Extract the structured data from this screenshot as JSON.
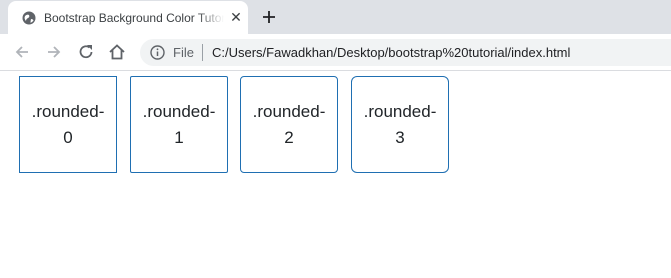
{
  "browser": {
    "tab": {
      "title": "Bootstrap Background Color Tutorial",
      "close_label": "✕"
    },
    "address": {
      "scheme_label": "File",
      "url": "C:/Users/Fawadkhan/Desktop/bootstrap%20tutorial/index.html"
    }
  },
  "page": {
    "boxes": [
      {
        "label": ".rounded-0"
      },
      {
        "label": ".rounded-1"
      },
      {
        "label": ".rounded-2"
      },
      {
        "label": ".rounded-3"
      }
    ]
  },
  "colors": {
    "box_border": "#1f6fb2",
    "tabstrip_bg": "#dee1e6",
    "omnibox_bg": "#f1f3f4"
  }
}
